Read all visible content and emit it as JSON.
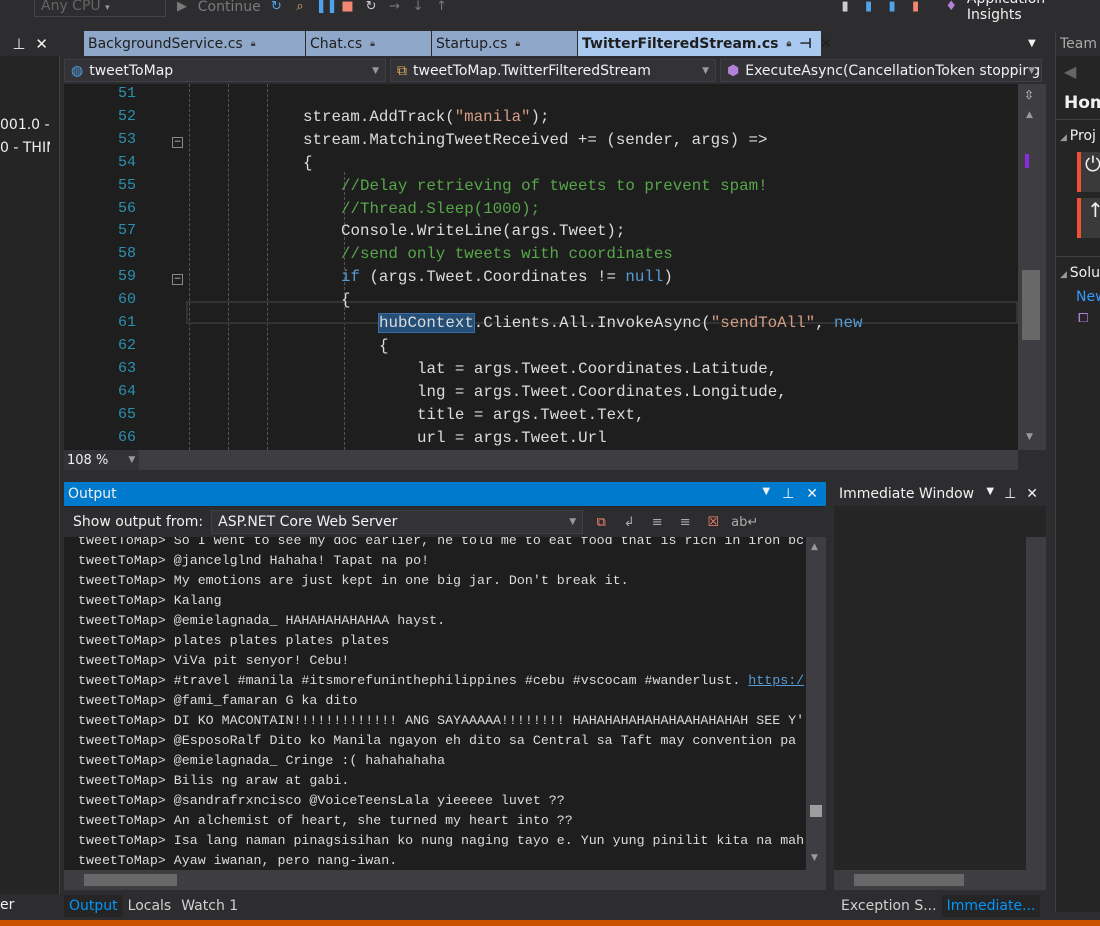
{
  "toolbar": {
    "platform": "Any CPU",
    "continue_label": "Continue",
    "app_insights": "Application Insights"
  },
  "left_panel": {
    "lines": [
      "001.0 - ",
      "0 - THIN"
    ],
    "bottom_tab": "er"
  },
  "tabs": [
    {
      "label": "BackgroundService.cs",
      "active": false
    },
    {
      "label": "Chat.cs",
      "active": false
    },
    {
      "label": "Startup.cs",
      "active": false
    },
    {
      "label": "TwitterFilteredStream.cs",
      "active": true
    }
  ],
  "navbar": {
    "project": "tweetToMap",
    "class": "tweetToMap.TwitterFilteredStream",
    "member": "ExecuteAsync(CancellationToken stopping"
  },
  "editor": {
    "zoom": "108 %",
    "lines": [
      {
        "n": "51",
        "indent": 0,
        "tokens": []
      },
      {
        "n": "52",
        "indent": 12,
        "tokens": [
          [
            "",
            "stream.AddTrack("
          ],
          [
            "str",
            "\"manila\""
          ],
          [
            "",
            ");"
          ]
        ]
      },
      {
        "n": "53",
        "indent": 12,
        "tokens": [
          [
            "",
            "stream.MatchingTweetReceived += (sender, args) =>"
          ]
        ],
        "fold": true
      },
      {
        "n": "54",
        "indent": 12,
        "tokens": [
          [
            "",
            "{"
          ]
        ]
      },
      {
        "n": "55",
        "indent": 16,
        "tokens": [
          [
            "cmt",
            "//Delay retrieving of tweets to prevent spam!"
          ]
        ]
      },
      {
        "n": "56",
        "indent": 16,
        "tokens": [
          [
            "cmt",
            "//Thread.Sleep(1000);"
          ]
        ]
      },
      {
        "n": "57",
        "indent": 16,
        "tokens": [
          [
            "",
            "Console.WriteLine(args.Tweet);"
          ]
        ]
      },
      {
        "n": "58",
        "indent": 16,
        "tokens": [
          [
            "cmt",
            "//send only tweets with coordinates"
          ]
        ]
      },
      {
        "n": "59",
        "indent": 16,
        "tokens": [
          [
            "kw",
            "if"
          ],
          [
            "",
            " (args.Tweet.Coordinates != "
          ],
          [
            "kw",
            "null"
          ],
          [
            "",
            ")"
          ]
        ],
        "fold": true
      },
      {
        "n": "60",
        "indent": 16,
        "tokens": [
          [
            "",
            "{"
          ]
        ]
      },
      {
        "n": "61",
        "indent": 20,
        "tokens": [
          [
            "sel",
            "hubContext"
          ],
          [
            "",
            ".Clients.All.InvokeAsync("
          ],
          [
            "str",
            "\"sendToAll\""
          ],
          [
            "",
            ", "
          ],
          [
            "kw",
            "new"
          ]
        ]
      },
      {
        "n": "62",
        "indent": 20,
        "tokens": [
          [
            "",
            "{"
          ]
        ]
      },
      {
        "n": "63",
        "indent": 24,
        "tokens": [
          [
            "",
            "lat = args.Tweet.Coordinates.Latitude,"
          ]
        ]
      },
      {
        "n": "64",
        "indent": 24,
        "tokens": [
          [
            "",
            "lng = args.Tweet.Coordinates.Longitude,"
          ]
        ]
      },
      {
        "n": "65",
        "indent": 24,
        "tokens": [
          [
            "",
            "title = args.Tweet.Text,"
          ]
        ]
      },
      {
        "n": "66",
        "indent": 24,
        "tokens": [
          [
            "",
            "url = args.Tweet.Url"
          ]
        ]
      },
      {
        "n": "67",
        "indent": 20,
        "tokens": [
          [
            "",
            "});"
          ]
        ]
      }
    ]
  },
  "output": {
    "title": "Output",
    "show_from_label": "Show output from:",
    "source": "ASP.NET Core Web Server",
    "prefix": "tweetToMap> ",
    "lines": [
      {
        "text": "So I went to see my doc earlier, he told me to eat food that is rich in iron bc"
      },
      {
        "text": "@jancelglnd Hahaha! Tapat na po!"
      },
      {
        "text": "My emotions are just kept in one big jar. Don't break it."
      },
      {
        "text": "Kalang"
      },
      {
        "text": "@emielagnada_ HAHAHAHAHAHAA hayst."
      },
      {
        "text": "plates plates plates plates"
      },
      {
        "text": "ViVa pit senyor! Cebu!"
      },
      {
        "text": "#travel #manila #itsmorefuninthephilippines #cebu #vscocam #wanderlust. ",
        "link": "https:/"
      },
      {
        "text": "@fami_famaran G ka dito"
      },
      {
        "text": "DI KO MACONTAIN!!!!!!!!!!!!! ANG SAYAAAAA!!!!!!!! HAHAHAHAHAHAHAAHAHAHAH SEE Y'"
      },
      {
        "text": "@EsposoRalf Dito ko Manila ngayon eh dito sa Central sa Taft may convention pa"
      },
      {
        "text": "@emielagnada_ Cringe :( hahahahaha"
      },
      {
        "text": "Bilis ng araw at gabi."
      },
      {
        "text": "@sandrafrxncisco @VoiceTeensLala yieeeee luvet ??"
      },
      {
        "text": "An alchemist of heart, she turned my heart into ??"
      },
      {
        "text": "Isa lang naman pinagsisihan ko nung naging tayo e. Yun yung pinilit kita na mah"
      },
      {
        "text": "Ayaw iwanan, pero nang-iwan."
      }
    ]
  },
  "immediate": {
    "title": "Immediate Window"
  },
  "bottom_tabs_left": [
    {
      "label": "Output",
      "active": true
    },
    {
      "label": "Locals",
      "active": false
    },
    {
      "label": "Watch 1",
      "active": false
    }
  ],
  "bottom_tabs_right": [
    {
      "label": "Exception S...",
      "active": false
    },
    {
      "label": "Immediate...",
      "active": true
    }
  ],
  "team": {
    "title": "Team",
    "home": "Hom",
    "projects": "Proj",
    "solutions": "Solu",
    "new_link": "New"
  },
  "colors": {
    "accent": "#007acc",
    "status_bar": "#ca5100",
    "active_tab": "#a9c9f1"
  }
}
